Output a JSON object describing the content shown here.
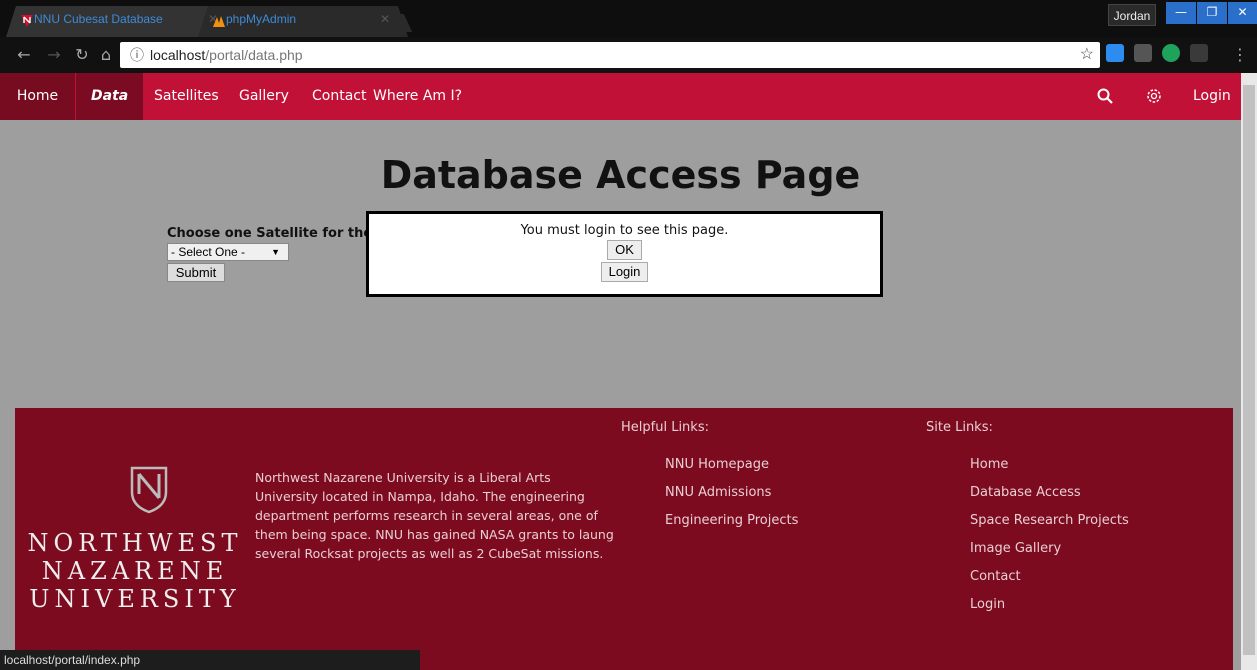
{
  "browser": {
    "tabs": [
      {
        "title": "NNU Cubesat Database",
        "active": true,
        "icon": "nnu-favicon"
      },
      {
        "title": "phpMyAdmin",
        "active": false,
        "icon": "phpmyadmin-favicon"
      }
    ],
    "profile_name": "Jordan",
    "url_host": "localhost",
    "url_path": "/portal/data.php",
    "status_url": "localhost/portal/index.php"
  },
  "nav": {
    "items": [
      "Home",
      "Data",
      "Satellites",
      "Gallery",
      "Contact",
      "Where Am I?"
    ],
    "active": "Data",
    "login_label": "Login"
  },
  "main": {
    "title": "Database Access Page",
    "form_label": "Choose one Satellite for the Da",
    "select_value": "- Select One -",
    "submit_label": "Submit"
  },
  "modal": {
    "message": "You must login to see this page.",
    "ok_label": "OK",
    "login_label": "Login"
  },
  "footer": {
    "logo_lines": [
      "NORTHWEST",
      "NAZARENE",
      "UNIVERSITY"
    ],
    "about": "Northwest Nazarene University is a Liberal Arts University located in Nampa, Idaho. The engineering department performs research in several areas, one of them being space. NNU has gained NASA grants to laung several Rocksat projects as well as 2 CubeSat missions.",
    "helpful_title": "Helpful Links:",
    "helpful_links": [
      "NNU Homepage",
      "NNU Admissions",
      "Engineering Projects"
    ],
    "site_title": "Site Links:",
    "site_links": [
      "Home",
      "Database Access",
      "Space Research Projects",
      "Image Gallery",
      "Contact",
      "Login"
    ]
  },
  "colors": {
    "navbar": "#c21137",
    "footer": "#7d0b1f",
    "page_bg": "#9e9e9e"
  }
}
